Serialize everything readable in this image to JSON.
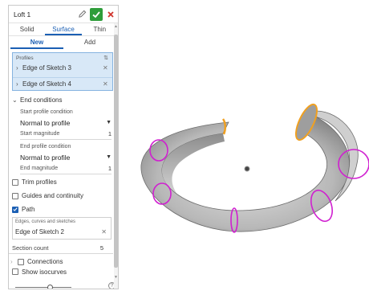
{
  "feature": {
    "title": "Loft 1"
  },
  "tabs": [
    {
      "label": "Solid"
    },
    {
      "label": "Surface"
    },
    {
      "label": "Thin"
    }
  ],
  "subtabs": [
    {
      "label": "New"
    },
    {
      "label": "Add"
    }
  ],
  "profiles": {
    "label": "Profiles",
    "items": [
      {
        "label": "Edge of Sketch 3"
      },
      {
        "label": "Edge of Sketch 4"
      }
    ]
  },
  "end_conditions": {
    "label": "End conditions",
    "start_condition_label": "Start profile condition",
    "start_condition_value": "Normal to profile",
    "start_magnitude_label": "Start magnitude",
    "start_magnitude_value": "1",
    "end_condition_label": "End profile condition",
    "end_condition_value": "Normal to profile",
    "end_magnitude_label": "End magnitude",
    "end_magnitude_value": "1"
  },
  "options": {
    "trim_profiles": {
      "label": "Trim profiles",
      "checked": false
    },
    "guides": {
      "label": "Guides and continuity",
      "checked": false
    },
    "path": {
      "label": "Path",
      "checked": true
    }
  },
  "path_selection": {
    "label": "Edges, curves and sketches",
    "value": "Edge of Sketch 2"
  },
  "section_count": {
    "label": "Section count",
    "value": "5"
  },
  "connections": {
    "label": "Connections",
    "checked": false
  },
  "show_isocurves": {
    "label": "Show isocurves",
    "checked": false
  },
  "colors": {
    "accent": "#1b5fb4",
    "confirm": "#2e9d3a",
    "cancel": "#d0342c",
    "profile_edge": "#f0a020",
    "section_edge": "#d020d0",
    "surface": "#9a9a9a"
  },
  "icons": {
    "edit": "pencil-icon",
    "accept": "check-icon",
    "cancel": "close-icon",
    "help": "help-icon"
  }
}
